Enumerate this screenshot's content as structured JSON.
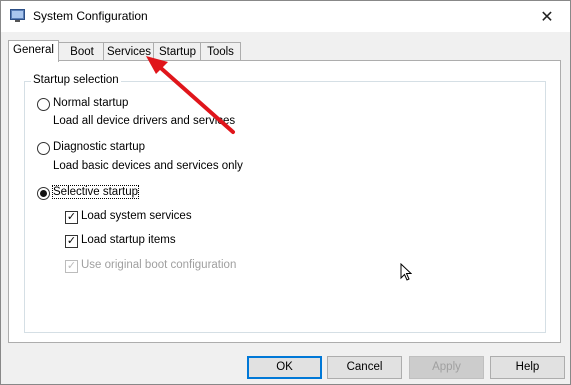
{
  "window": {
    "title": "System Configuration"
  },
  "tabs": [
    {
      "label": "General"
    },
    {
      "label": "Boot"
    },
    {
      "label": "Services"
    },
    {
      "label": "Startup"
    },
    {
      "label": "Tools"
    }
  ],
  "startup_selection": {
    "title": "Startup selection",
    "normal": {
      "label": "Normal startup",
      "desc": "Load all device drivers and services",
      "selected": false
    },
    "diagnostic": {
      "label": "Diagnostic startup",
      "desc": "Load basic devices and services only",
      "selected": false
    },
    "selective": {
      "label": "Selective startup",
      "selected": true,
      "options": [
        {
          "label": "Load system services",
          "checked": true,
          "enabled": true
        },
        {
          "label": "Load startup items",
          "checked": true,
          "enabled": true
        },
        {
          "label": "Use original boot configuration",
          "checked": true,
          "enabled": false
        }
      ]
    }
  },
  "buttons": {
    "ok": "OK",
    "cancel": "Cancel",
    "apply": "Apply",
    "help": "Help"
  },
  "annotation": {
    "arrow_color": "#e0151b"
  }
}
